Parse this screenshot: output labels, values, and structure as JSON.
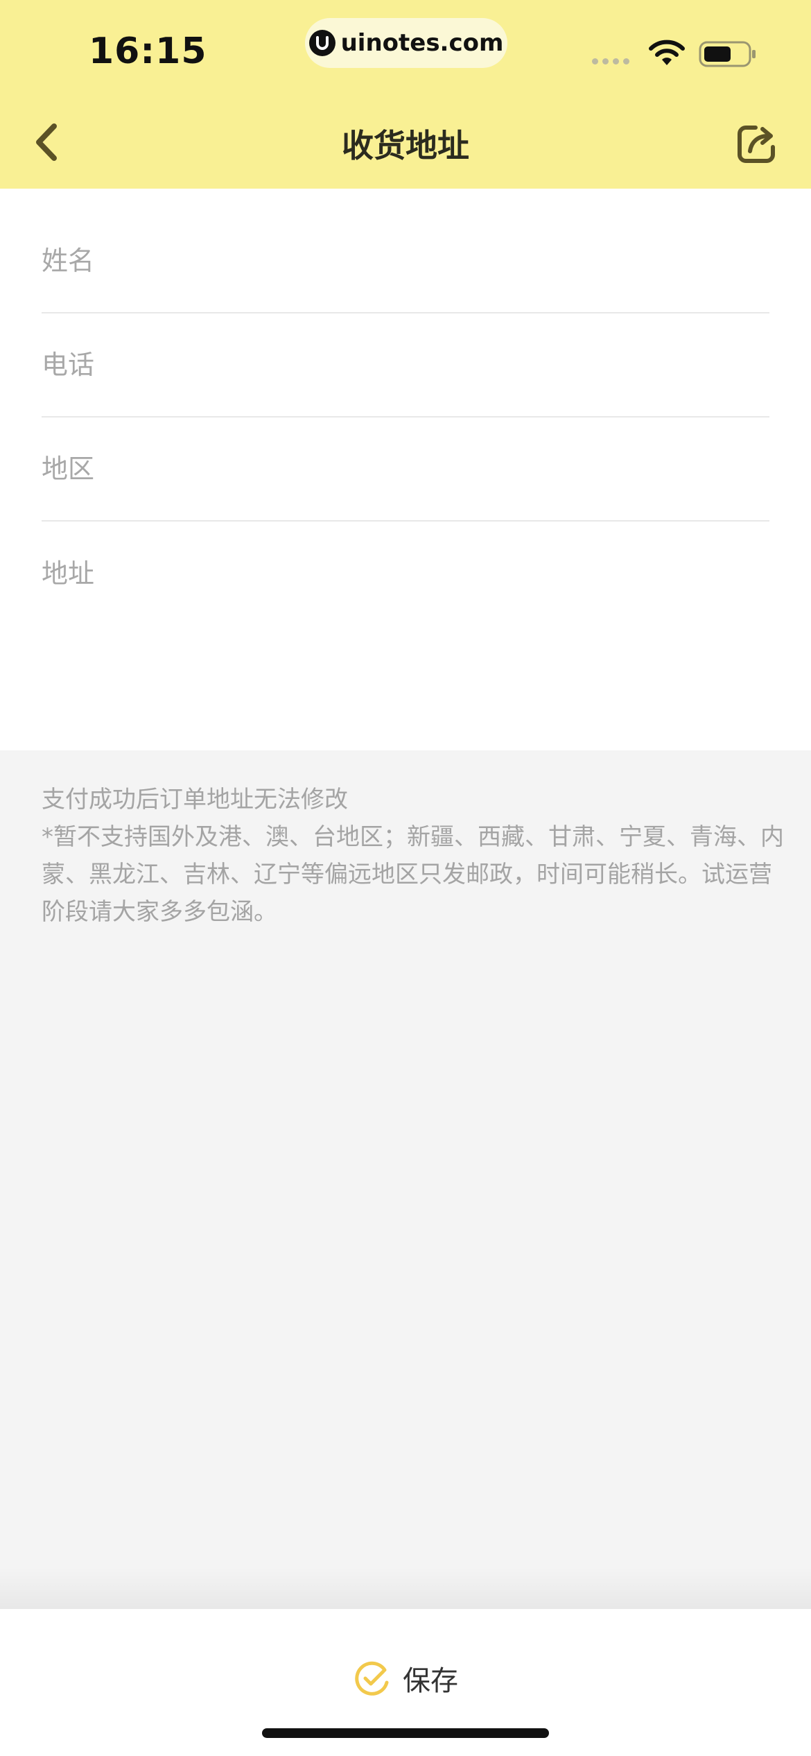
{
  "status_bar": {
    "time": "16:15",
    "url": "uinotes.com"
  },
  "nav": {
    "title": "收货地址",
    "back_icon": "chevron-left-icon",
    "share_icon": "share-icon"
  },
  "form": {
    "name_placeholder": "姓名",
    "phone_placeholder": "电话",
    "region_placeholder": "地区",
    "address_placeholder": "地址"
  },
  "notes": {
    "line1": "支付成功后订单地址无法修改",
    "line2": "*暂不支持国外及港、澳、台地区；新疆、西藏、甘肃、宁夏、青海、内蒙、黑龙江、吉林、辽宁等偏远地区只发邮政，时间可能稍长。试运营阶段请大家多多包涵。"
  },
  "bottom": {
    "save_label": "保存"
  },
  "colors": {
    "header_bg": "#f9f094",
    "accent": "#f2c94c",
    "page_bg": "#f4f4f4"
  }
}
